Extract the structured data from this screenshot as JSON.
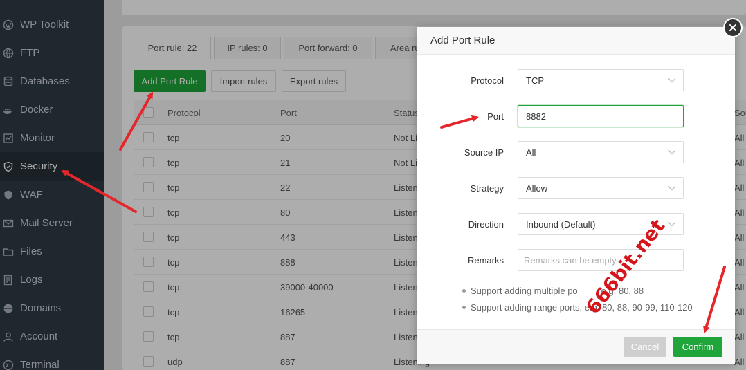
{
  "sidebar": {
    "items": [
      {
        "label": "WP Toolkit",
        "icon": "wordpress-icon"
      },
      {
        "label": "FTP",
        "icon": "globe-icon"
      },
      {
        "label": "Databases",
        "icon": "database-icon"
      },
      {
        "label": "Docker",
        "icon": "docker-icon"
      },
      {
        "label": "Monitor",
        "icon": "monitor-icon"
      },
      {
        "label": "Security",
        "icon": "shield-icon",
        "active": true
      },
      {
        "label": "WAF",
        "icon": "waf-shield-icon"
      },
      {
        "label": "Mail Server",
        "icon": "mail-icon"
      },
      {
        "label": "Files",
        "icon": "folder-icon"
      },
      {
        "label": "Logs",
        "icon": "log-icon"
      },
      {
        "label": "Domains",
        "icon": "globe-icon"
      },
      {
        "label": "Account",
        "icon": "user-icon"
      },
      {
        "label": "Terminal",
        "icon": "terminal-icon"
      }
    ]
  },
  "tabs": [
    {
      "label": "Port rule: 22",
      "active": true
    },
    {
      "label": "IP rules: 0"
    },
    {
      "label": "Port forward: 0"
    },
    {
      "label": "Area ru"
    }
  ],
  "toolbar": {
    "add_label": "Add Port Rule",
    "import_label": "Import rules",
    "export_label": "Export rules"
  },
  "table": {
    "headers": {
      "protocol": "Protocol",
      "port": "Port",
      "status": "Status",
      "source": "Sou"
    },
    "rows": [
      {
        "protocol": "tcp",
        "port": "20",
        "status": "Not Li",
        "source": "All"
      },
      {
        "protocol": "tcp",
        "port": "21",
        "status": "Not Li",
        "source": "All"
      },
      {
        "protocol": "tcp",
        "port": "22",
        "status": "Listen",
        "source": "All"
      },
      {
        "protocol": "tcp",
        "port": "80",
        "status": "Listen",
        "source": "All"
      },
      {
        "protocol": "tcp",
        "port": "443",
        "status": "Listen",
        "source": "All"
      },
      {
        "protocol": "tcp",
        "port": "888",
        "status": "Listen",
        "source": "All"
      },
      {
        "protocol": "tcp",
        "port": "39000-40000",
        "status": "Listen",
        "source": "All"
      },
      {
        "protocol": "tcp",
        "port": "16265",
        "status": "Listen",
        "source": "All"
      },
      {
        "protocol": "tcp",
        "port": "887",
        "status": "Listen",
        "source": "All"
      },
      {
        "protocol": "udp",
        "port": "887",
        "status": "Listening",
        "source": "All"
      }
    ]
  },
  "modal": {
    "title": "Add Port Rule",
    "fields": {
      "protocol": {
        "label": "Protocol",
        "value": "TCP"
      },
      "port": {
        "label": "Port",
        "value": "8882"
      },
      "source_ip": {
        "label": "Source IP",
        "value": "All"
      },
      "strategy": {
        "label": "Strategy",
        "value": "Allow"
      },
      "direction": {
        "label": "Direction",
        "value": "Inbound (Default)"
      },
      "remarks": {
        "label": "Remarks",
        "placeholder": "Remarks can be empty"
      }
    },
    "tips": [
      "Support adding multiple po",
      "e.g. 80, 88",
      "Support adding range ports, e.g. 80, 88, 90-99, 110-120"
    ],
    "cancel_label": "Cancel",
    "confirm_label": "Confirm"
  },
  "watermark": "666bit.net",
  "colors": {
    "accent": "#20a53a",
    "sidebar": "#2f3a46",
    "annotation": "#e5262b"
  }
}
